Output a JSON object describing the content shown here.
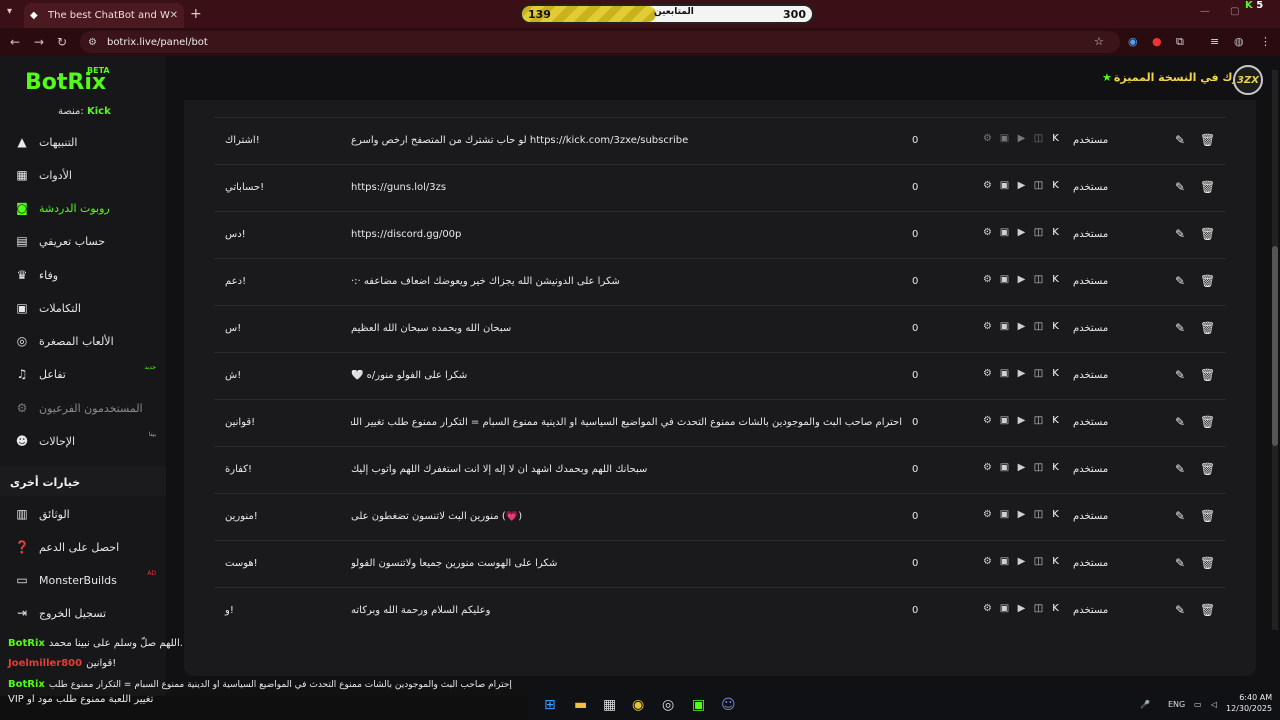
{
  "browser": {
    "tab_title": "The best ChatBot and Widgets",
    "url": "botrix.live/panel/bot",
    "new_tab_symbol": "+",
    "followers_goal": {
      "current": "139",
      "label": "المتابعين",
      "goal": "300",
      "progress_fraction": 0.463
    },
    "kick_count": "5"
  },
  "app": {
    "logo": "BotRix",
    "logo_tag": "BETA",
    "platform_label": "منصة:",
    "platform_value": "Kick",
    "premium_text": "اشترك في النسخة المميزة",
    "avatar_text": "3ZX",
    "accent": "#53fc18"
  },
  "sidebar": {
    "items": [
      {
        "label": "التنبيهات",
        "icon": "warning-icon"
      },
      {
        "label": "الأدوات",
        "icon": "widgets-icon"
      },
      {
        "label": "روبوت الدردشة",
        "icon": "robot-icon"
      },
      {
        "label": "حساب تعريفي",
        "icon": "profile-card-icon"
      },
      {
        "label": "وفاء",
        "icon": "trophy-icon"
      },
      {
        "label": "التكاملات",
        "icon": "integrations-icon"
      },
      {
        "label": "الألعاب المصغرة",
        "icon": "gamepad-icon"
      },
      {
        "label": "تفاعل",
        "icon": "music-icon",
        "badge": "جديد"
      },
      {
        "label": "المستخدمون الفرعيون",
        "icon": "subusers-icon"
      },
      {
        "label": "الإحالات",
        "icon": "referrals-icon",
        "badge": "بيتا"
      }
    ],
    "other_title": "خيارات أخرى",
    "other_items": [
      {
        "label": "الوثائق",
        "icon": "docs-icon"
      },
      {
        "label": "احصل على الدعم",
        "icon": "help-icon"
      },
      {
        "label": "MonsterBuilds",
        "icon": "laptop-icon",
        "badge": "AD"
      },
      {
        "label": "تسجيل الخروج",
        "icon": "logout-icon"
      }
    ]
  },
  "commands": [
    {
      "command": "اشتراك!",
      "response": "https://kick.com/3zxe/subscribe لو حاب تشترك من المتصفح ارخص واسرع",
      "count": "0",
      "role": "مستخدم"
    },
    {
      "command": "حساباتي!",
      "response": "https://guns.lol/3zs",
      "count": "0",
      "role": "مستخدم"
    },
    {
      "command": "دس!",
      "response": "https://discord.gg/00p",
      "count": "0",
      "role": "مستخدم"
    },
    {
      "command": "دعم!",
      "response": "شكراً على الدونيشن الله يجزاك خير ويعوضك اضعاف مضاعفه ·:·",
      "count": "0",
      "role": "مستخدم"
    },
    {
      "command": "س!",
      "response": "سبحان الله وبحمده سبحان الله العظيم",
      "count": "0",
      "role": "مستخدم"
    },
    {
      "command": "ش!",
      "response": "شكرا على الفولو منور/ه 🤍",
      "count": "0",
      "role": "مستخدم"
    },
    {
      "command": "قوانين!",
      "response": "احترام صاحب البث والموجودين بالشات ممنوع التحدث في المواضيع السياسية او الدينية ممنوع السبام = التكرار ممنوع طلب تغيير اللعبة ممنوع طلب مود او",
      "count": "0",
      "role": "مستخدم"
    },
    {
      "command": "كفارة!",
      "response": "سبحانك اللهم وبحمدك أشهد أن لا إله إلا أنت أستغفرك اللهم وأتوب إليك",
      "count": "0",
      "role": "مستخدم"
    },
    {
      "command": "منورين!",
      "response": "(💗) منورين البث لاتنسون تضغطون على",
      "count": "0",
      "role": "مستخدم"
    },
    {
      "command": "هوست!",
      "response": "شكراً على الهوست منورين جميعاً ولاتنسون الفولو",
      "count": "0",
      "role": "مستخدم"
    },
    {
      "command": "و!",
      "response": "وعليكم السلام ورحمة الله وبركاته",
      "count": "0",
      "role": "مستخدم"
    }
  ],
  "chat": [
    {
      "name": "BotRix",
      "color": "#53fc18",
      "text": "اللهم صلّ وسلم على نبينا محمد."
    },
    {
      "name": "Joelmiller800",
      "color": "#e83a3a",
      "text": "قوانين!"
    },
    {
      "name": "BotRix",
      "color": "#53fc18",
      "text": "إحترام صاحب البث والموجودين بالشات ممنوع التحدث في المواضيع السياسية او الدينية ممنوع السبام = التكرار ممنوع طلب"
    },
    {
      "name": "",
      "color": "#ffffff",
      "text": "VIP تغيير اللعبة ممنوع طلب مود او"
    }
  ],
  "taskbar": {
    "lang": "ENG",
    "time": "6:40 AM",
    "date": "12/30/2025"
  }
}
